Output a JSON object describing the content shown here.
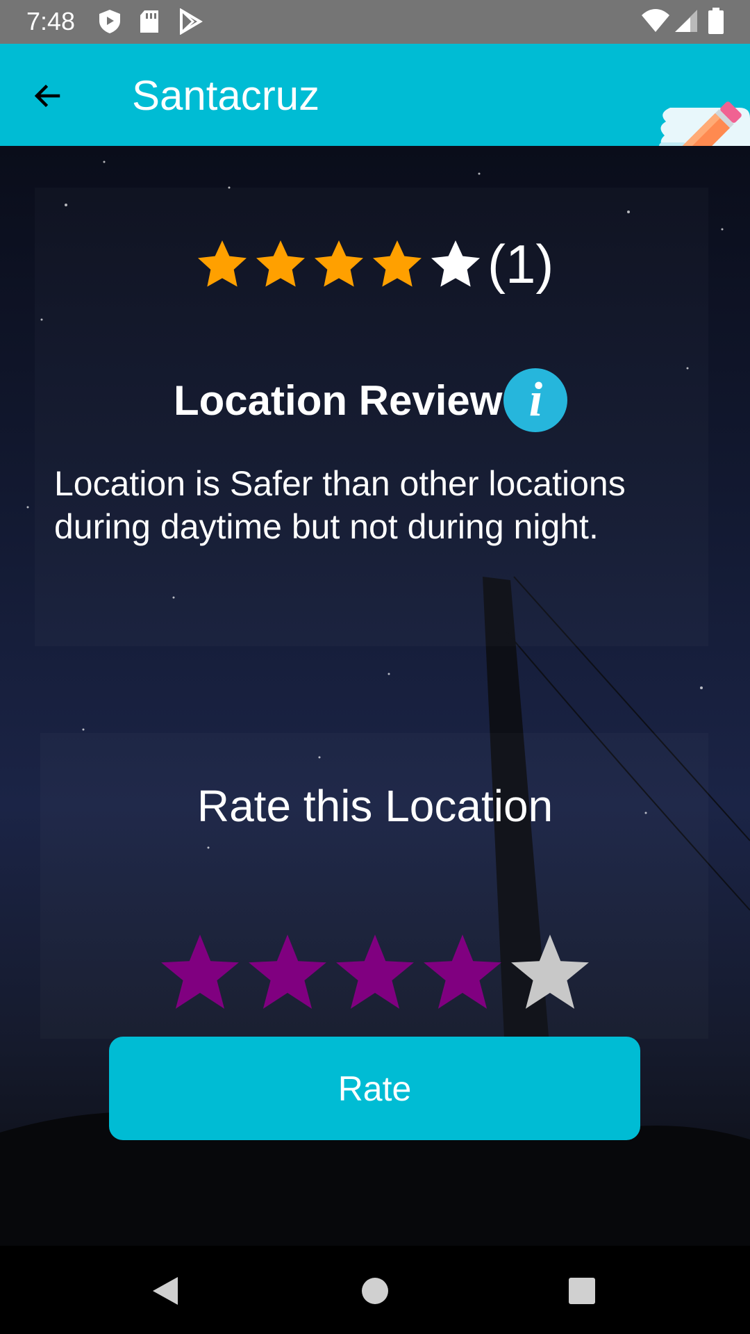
{
  "status_bar": {
    "time": "7:48",
    "icons": [
      "shield-icon",
      "sd-card-icon",
      "play-store-icon",
      "wifi-icon",
      "signal-icon",
      "battery-icon"
    ]
  },
  "app_bar": {
    "title": "Santacruz",
    "back_icon": "arrow-left-icon",
    "action_icon": "pencil-logo-icon"
  },
  "overall_rating": {
    "stars_filled": 4,
    "stars_total": 5,
    "count_label": "(1)",
    "filled_color": "#FFA000",
    "empty_color": "#FFFFFF"
  },
  "review": {
    "title": "Location Review",
    "info_icon": "info-icon",
    "text": "Location is Safer than other locations during daytime but not during night."
  },
  "rate_section": {
    "heading": "Rate this Location",
    "selected_stars": 4,
    "stars_total": 5,
    "selected_color": "#800080",
    "unselected_color": "#C8C8C8",
    "button_label": "Rate",
    "button_color": "#00BCD4"
  },
  "nav_bar": {
    "icons": [
      "back-triangle-icon",
      "home-circle-icon",
      "recents-square-icon"
    ]
  }
}
